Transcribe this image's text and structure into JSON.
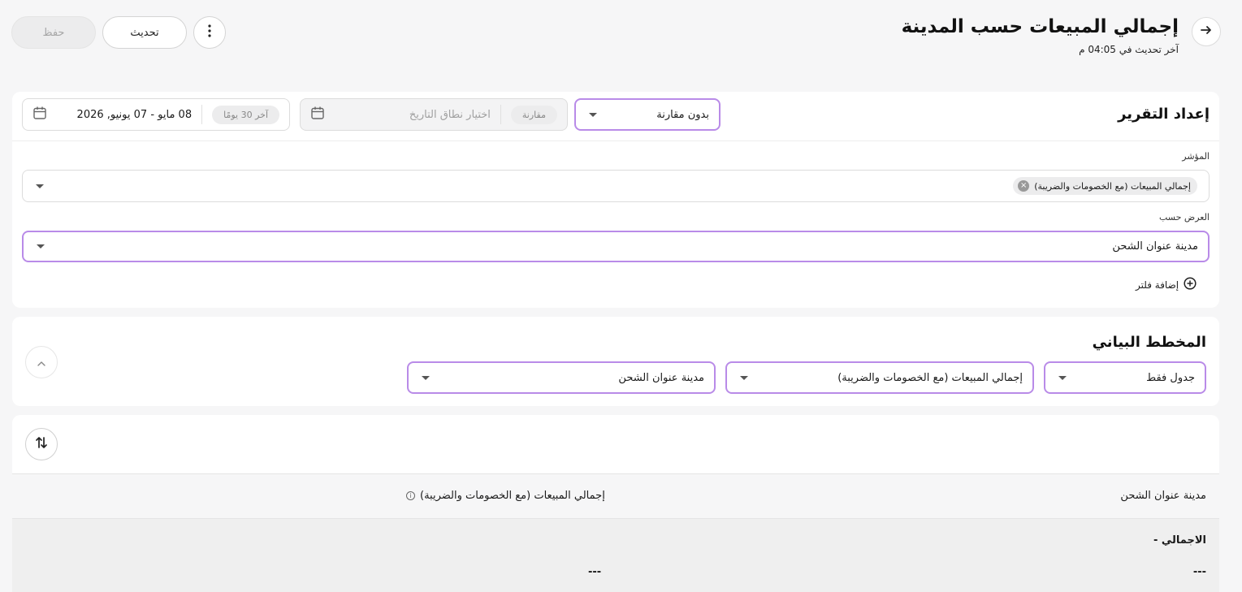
{
  "header": {
    "title": "إجمالي المبيعات حسب المدينة",
    "last_update": "آخر تحديث في 04:05 م",
    "save_label": "حفظ",
    "refresh_label": "تحديث"
  },
  "report_setup": {
    "title": "إعداد التقرير",
    "comparison_select": "بدون مقارنة",
    "compare_chip": "مقارنة",
    "compare_placeholder": "اختيار نطاق التاريخ",
    "range_chip": "آخر 30 يومًا",
    "date_range": "08 مايو - 07 يونيو, 2026",
    "metric_label": "المؤشر",
    "metric_tag": "إجمالي المبيعات (مع الخصومات والضريبة)",
    "group_by_label": "العرض حسب",
    "group_by_value": "مدينة عنوان الشحن",
    "add_filter_label": "إضافة فلتر"
  },
  "chart": {
    "title": "المخطط البياني",
    "view_select": "جدول فقط",
    "metric_select": "إجمالي المبيعات (مع الخصومات والضريبة)",
    "dimension_select": "مدينة عنوان الشحن"
  },
  "table": {
    "columns": [
      "مدينة عنوان الشحن",
      "إجمالي المبيعات (مع الخصومات والضريبة)"
    ],
    "total_label": "الاجمالي -",
    "total_values": [
      "---",
      "---"
    ]
  },
  "icons": {
    "back": "arrow-right-icon",
    "more": "vertical-dots-icon",
    "calendar": "calendar-icon",
    "add_filter": "plus-circle-icon",
    "collapse": "chevron-up-icon",
    "sort": "sort-arrows-icon",
    "info": "info-icon"
  },
  "colors": {
    "accent_border": "#b98be8",
    "background": "#f6f6f7"
  }
}
